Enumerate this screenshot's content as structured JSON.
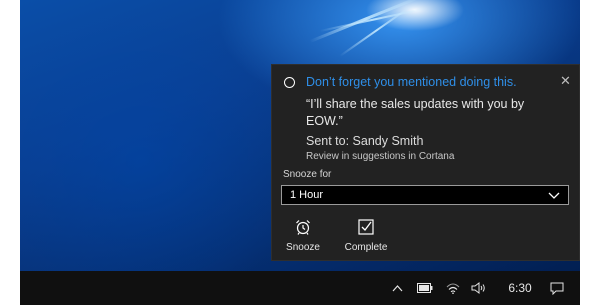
{
  "notification": {
    "title": "Don’t forget you mentioned doing this.",
    "quote": "“I’ll share the sales updates with you by EOW.”",
    "sent_to": "Sent to: Sandy Smith",
    "review": "Review in suggestions in Cortana",
    "snooze_label": "Snooze for",
    "snooze_selected": "1 Hour",
    "actions": {
      "snooze": "Snooze",
      "complete": "Complete"
    },
    "colors": {
      "title": "#2f8fe8",
      "background": "#222222"
    },
    "icons": {
      "status": "circle-icon",
      "close": "close-icon",
      "snooze": "alarm-clock-icon",
      "complete": "checkbox-icon",
      "dropdown": "chevron-down-icon"
    }
  },
  "taskbar": {
    "time": "6:30",
    "icons": [
      "chevron-up-icon",
      "battery-icon",
      "wifi-icon",
      "volume-icon",
      "action-center-icon"
    ]
  }
}
